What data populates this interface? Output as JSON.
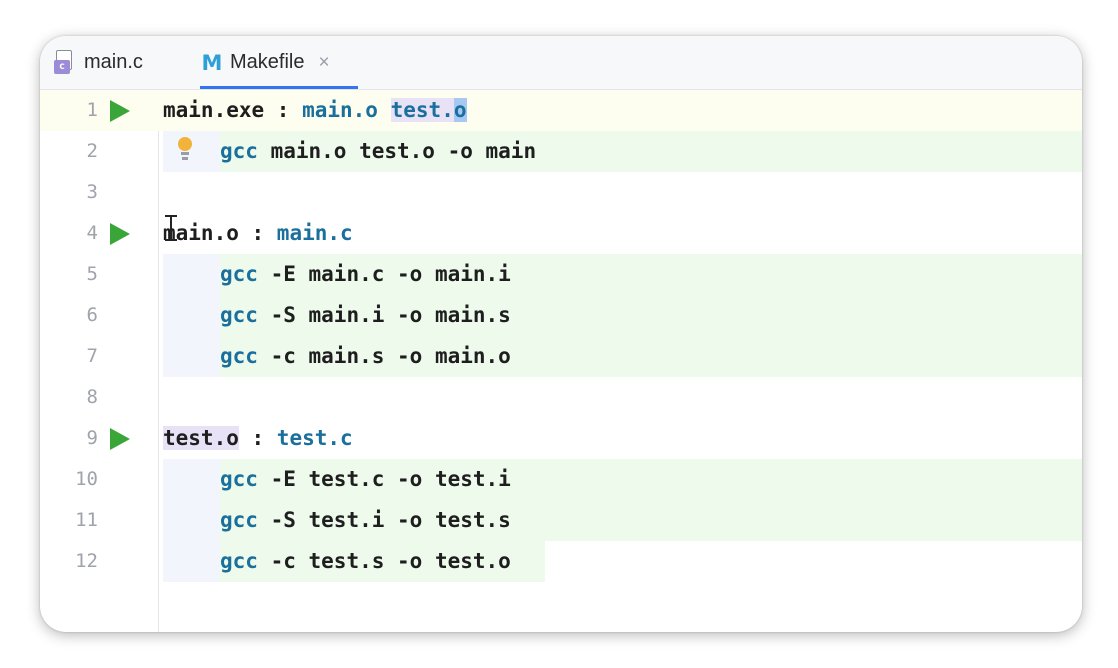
{
  "tabs": [
    {
      "label": "main.c",
      "icon": "c-file-icon",
      "active": false
    },
    {
      "label": "Makefile",
      "icon": "makefile-icon",
      "active": true,
      "close": "×"
    }
  ],
  "makefile_icon_letter": "M",
  "c_icon_letter": "c",
  "lines": [
    {
      "num": "1",
      "run": true,
      "segments": [
        {
          "text": "main.exe",
          "cls": "t"
        },
        {
          "text": " : ",
          "cls": "t"
        },
        {
          "text": "main.o",
          "cls": "k"
        },
        {
          "text": " "
        },
        {
          "text": "test",
          "cls": "k sel-purple"
        },
        {
          "text": ".",
          "cls": "k sel-purple"
        },
        {
          "text": "o",
          "cls": "k sel-blue"
        }
      ]
    },
    {
      "num": "2",
      "run": false,
      "bulb": true,
      "segments": [
        {
          "text": "gcc",
          "cls": "k"
        },
        {
          "text": " main.o test.o -o main",
          "cls": "t"
        }
      ]
    },
    {
      "num": "3",
      "run": false,
      "segments": []
    },
    {
      "num": "4",
      "run": true,
      "segments": [
        {
          "text": "main.o",
          "cls": "t"
        },
        {
          "text": " : ",
          "cls": "t"
        },
        {
          "text": "main.c",
          "cls": "k"
        }
      ]
    },
    {
      "num": "5",
      "run": false,
      "segments": [
        {
          "text": "gcc",
          "cls": "k"
        },
        {
          "text": " -E main.c -o main.i",
          "cls": "t"
        }
      ]
    },
    {
      "num": "6",
      "run": false,
      "segments": [
        {
          "text": "gcc",
          "cls": "k"
        },
        {
          "text": " -S main.i -o main.s",
          "cls": "t"
        }
      ]
    },
    {
      "num": "7",
      "run": false,
      "segments": [
        {
          "text": "gcc",
          "cls": "k"
        },
        {
          "text": " -c main.s -o main.o",
          "cls": "t"
        }
      ]
    },
    {
      "num": "8",
      "run": false,
      "segments": []
    },
    {
      "num": "9",
      "run": true,
      "segments": [
        {
          "text": "test.o",
          "cls": "t sel-purple"
        },
        {
          "text": " : ",
          "cls": "t"
        },
        {
          "text": "test.c",
          "cls": "k"
        }
      ]
    },
    {
      "num": "10",
      "run": false,
      "segments": [
        {
          "text": "gcc",
          "cls": "k"
        },
        {
          "text": " -E test.c -o test.i",
          "cls": "t"
        }
      ]
    },
    {
      "num": "11",
      "run": false,
      "segments": [
        {
          "text": "gcc",
          "cls": "k"
        },
        {
          "text": " -S test.i -o test.s",
          "cls": "t"
        }
      ]
    },
    {
      "num": "12",
      "run": false,
      "segments": [
        {
          "text": "gcc",
          "cls": "k"
        },
        {
          "text": " -c test.s -o test.o",
          "cls": "t"
        }
      ]
    }
  ],
  "colors": {
    "keyword": "#1a6f9c",
    "run_gutter": "#3aa63a",
    "tab_underline": "#3574f0",
    "recipe_highlight": "#edfaec"
  }
}
